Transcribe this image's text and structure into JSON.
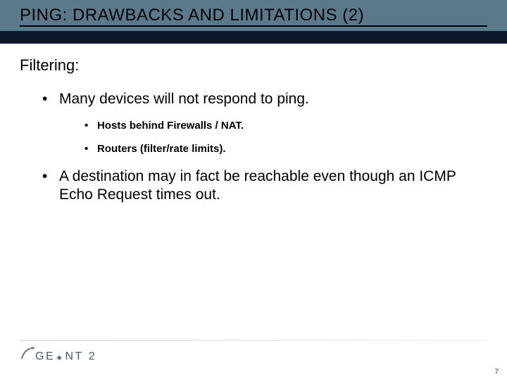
{
  "title": "PING: DRAWBACKS AND LIMITATIONS (2)",
  "subtitle": "Filtering:",
  "bullets": {
    "b1": "Many devices will not respond to ping.",
    "b1_sub1": "Hosts behind Firewalls / NAT.",
    "b1_sub2": "Routers (filter/rate limits).",
    "b2": "A destination may in fact be reachable even though an ICMP Echo Request times out."
  },
  "logo": {
    "part1": "GE",
    "part2": "NT",
    "num": "2"
  },
  "slide_number": "7"
}
